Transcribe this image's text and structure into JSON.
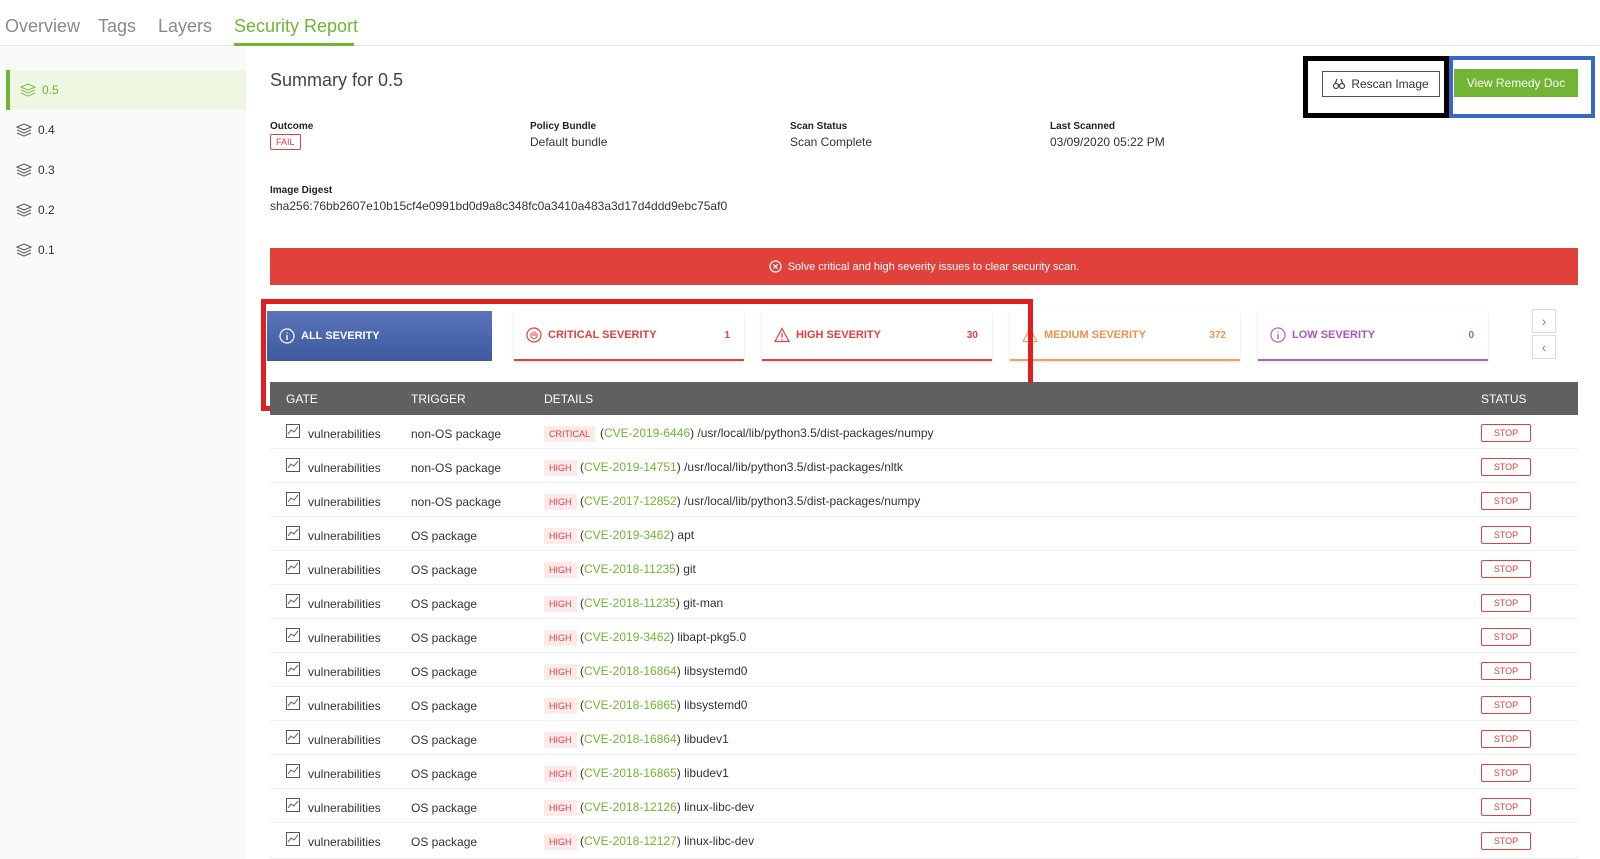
{
  "tabs": [
    "Overview",
    "Tags",
    "Layers",
    "Security Report"
  ],
  "sidebar": {
    "items": [
      {
        "label": "0.5",
        "active": true
      },
      {
        "label": "0.4",
        "active": false
      },
      {
        "label": "0.3",
        "active": false
      },
      {
        "label": "0.2",
        "active": false
      },
      {
        "label": "0.1",
        "active": false
      }
    ]
  },
  "summary": {
    "title": "Summary for 0.5",
    "rescan_label": "Rescan Image",
    "remedy_label": "View Remedy Doc",
    "outcome_label": "Outcome",
    "outcome_value": "FAIL",
    "policy_label": "Policy Bundle",
    "policy_value": "Default bundle",
    "scan_status_label": "Scan Status",
    "scan_status_value": "Scan Complete",
    "last_scanned_label": "Last Scanned",
    "last_scanned_value": "03/09/2020 05:22 PM",
    "digest_label": "Image Digest",
    "digest_value": "sha256:76bb2607e10b15cf4e0991bd0d9a8c348fc0a3410a483a3d17d4ddd9ebc75af0"
  },
  "banner": {
    "text": "Solve critical and high severity issues to clear security scan."
  },
  "severity": [
    {
      "label": "ALL SEVERITY",
      "count": "",
      "color": "#ffffff"
    },
    {
      "label": "CRITICAL SEVERITY",
      "count": "1",
      "color": "#e0413a"
    },
    {
      "label": "HIGH SEVERITY",
      "count": "30",
      "color": "#e0413a"
    },
    {
      "label": "MEDIUM SEVERITY",
      "count": "372",
      "color": "#f0a05a"
    },
    {
      "label": "LOW SEVERITY",
      "count": "0",
      "color": "#b060c8"
    }
  ],
  "table": {
    "headers": {
      "gate": "GATE",
      "trigger": "TRIGGER",
      "details": "DETAILS",
      "status": "STATUS"
    },
    "rows": [
      {
        "gate": "vulnerabilities",
        "trigger": "non-OS package",
        "severity": "CRITICAL",
        "cve": "CVE-2019-6446",
        "path": "/usr/local/lib/python3.5/dist-packages/numpy",
        "status": "STOP"
      },
      {
        "gate": "vulnerabilities",
        "trigger": "non-OS package",
        "severity": "HIGH",
        "cve": "CVE-2019-14751",
        "path": "/usr/local/lib/python3.5/dist-packages/nltk",
        "status": "STOP"
      },
      {
        "gate": "vulnerabilities",
        "trigger": "non-OS package",
        "severity": "HIGH",
        "cve": "CVE-2017-12852",
        "path": "/usr/local/lib/python3.5/dist-packages/numpy",
        "status": "STOP"
      },
      {
        "gate": "vulnerabilities",
        "trigger": "OS package",
        "severity": "HIGH",
        "cve": "CVE-2019-3462",
        "path": "apt",
        "status": "STOP"
      },
      {
        "gate": "vulnerabilities",
        "trigger": "OS package",
        "severity": "HIGH",
        "cve": "CVE-2018-11235",
        "path": "git",
        "status": "STOP"
      },
      {
        "gate": "vulnerabilities",
        "trigger": "OS package",
        "severity": "HIGH",
        "cve": "CVE-2018-11235",
        "path": "git-man",
        "status": "STOP"
      },
      {
        "gate": "vulnerabilities",
        "trigger": "OS package",
        "severity": "HIGH",
        "cve": "CVE-2019-3462",
        "path": "libapt-pkg5.0",
        "status": "STOP"
      },
      {
        "gate": "vulnerabilities",
        "trigger": "OS package",
        "severity": "HIGH",
        "cve": "CVE-2018-16864",
        "path": "libsystemd0",
        "status": "STOP"
      },
      {
        "gate": "vulnerabilities",
        "trigger": "OS package",
        "severity": "HIGH",
        "cve": "CVE-2018-16865",
        "path": "libsystemd0",
        "status": "STOP"
      },
      {
        "gate": "vulnerabilities",
        "trigger": "OS package",
        "severity": "HIGH",
        "cve": "CVE-2018-16864",
        "path": "libudev1",
        "status": "STOP"
      },
      {
        "gate": "vulnerabilities",
        "trigger": "OS package",
        "severity": "HIGH",
        "cve": "CVE-2018-16865",
        "path": "libudev1",
        "status": "STOP"
      },
      {
        "gate": "vulnerabilities",
        "trigger": "OS package",
        "severity": "HIGH",
        "cve": "CVE-2018-12126",
        "path": "linux-libc-dev",
        "status": "STOP"
      },
      {
        "gate": "vulnerabilities",
        "trigger": "OS package",
        "severity": "HIGH",
        "cve": "CVE-2018-12127",
        "path": "linux-libc-dev",
        "status": "STOP"
      }
    ]
  },
  "colors": {
    "accent": "#72b433",
    "danger": "#e0413a",
    "header": "#606060"
  }
}
